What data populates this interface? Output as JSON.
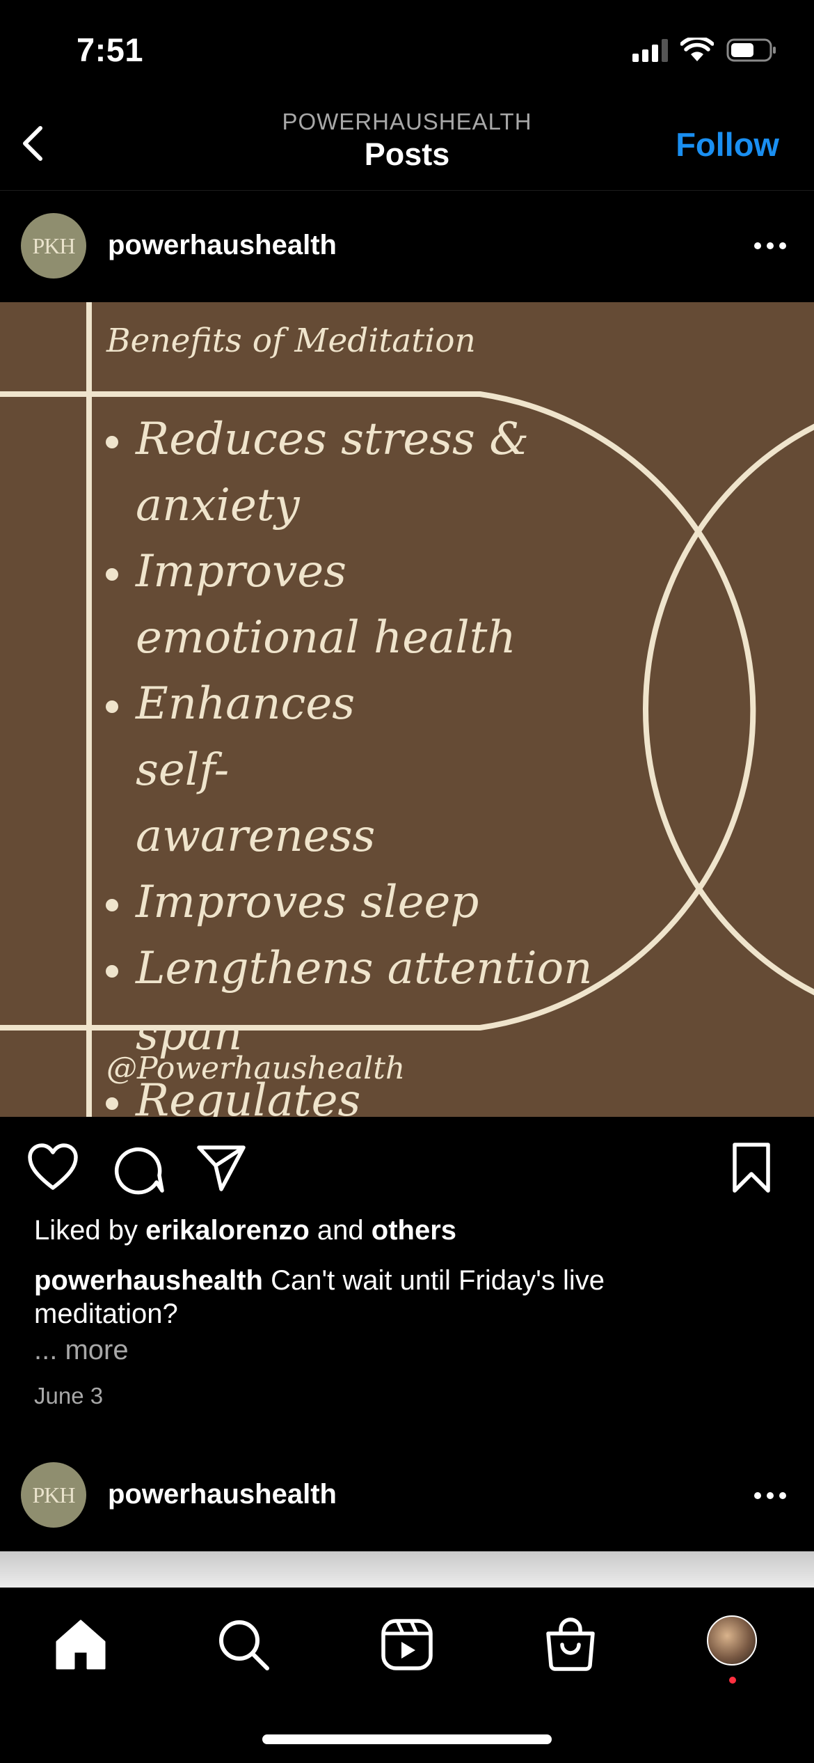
{
  "status_bar": {
    "time": "7:51"
  },
  "header": {
    "account": "POWERHAUSHEALTH",
    "title": "Posts",
    "follow_label": "Follow"
  },
  "post": {
    "avatar_text": "PKH",
    "username": "powerhaushealth",
    "image": {
      "title": "Benefits of Meditation",
      "benefits": [
        "Reduces stress & anxiety",
        "Improves emotional health",
        "Enhances self-awareness",
        "Improves sleep",
        "Lengthens attention span",
        "Regulates pain symptoms"
      ],
      "handle": "@Powerhaushealth",
      "background_color": "#654b35",
      "line_color": "#efe4cc"
    },
    "likes": {
      "prefix": "Liked by",
      "user": "erikalorenzo",
      "middle": "and",
      "others": "others"
    },
    "caption": {
      "username": "powerhaushealth",
      "text": "Can't wait until Friday's live meditation?"
    },
    "more_label": "... more",
    "date": "June 3"
  },
  "next_post": {
    "avatar_text": "PKH",
    "username": "powerhaushealth"
  },
  "icons": {
    "back": "chevron-left-icon",
    "more": "more-horizontal-icon",
    "like": "heart-icon",
    "comment": "comment-icon",
    "share": "send-icon",
    "save": "bookmark-icon",
    "tabs": [
      "home-icon",
      "search-icon",
      "reels-icon",
      "shop-icon",
      "profile-avatar"
    ]
  },
  "colors": {
    "accent": "#1a8ff1",
    "secondary_text": "#a8a8a8",
    "notification": "#ff3040"
  }
}
